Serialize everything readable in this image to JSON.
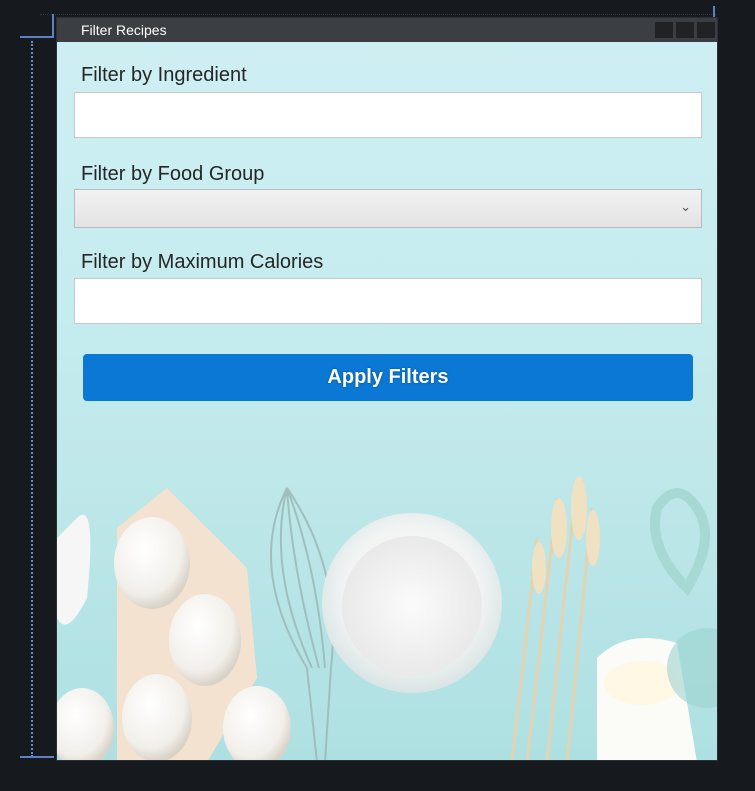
{
  "window": {
    "title": "Filter Recipes"
  },
  "filters": {
    "ingredient": {
      "label": "Filter by Ingredient",
      "value": ""
    },
    "food_group": {
      "label": "Filter by Food Group",
      "selected": ""
    },
    "max_calories": {
      "label": "Filter by Maximum Calories",
      "value": ""
    }
  },
  "actions": {
    "apply_label": "Apply Filters"
  },
  "colors": {
    "accent": "#0a78d4",
    "titlebar": "#3b3e43",
    "background": "#c5ecef"
  }
}
